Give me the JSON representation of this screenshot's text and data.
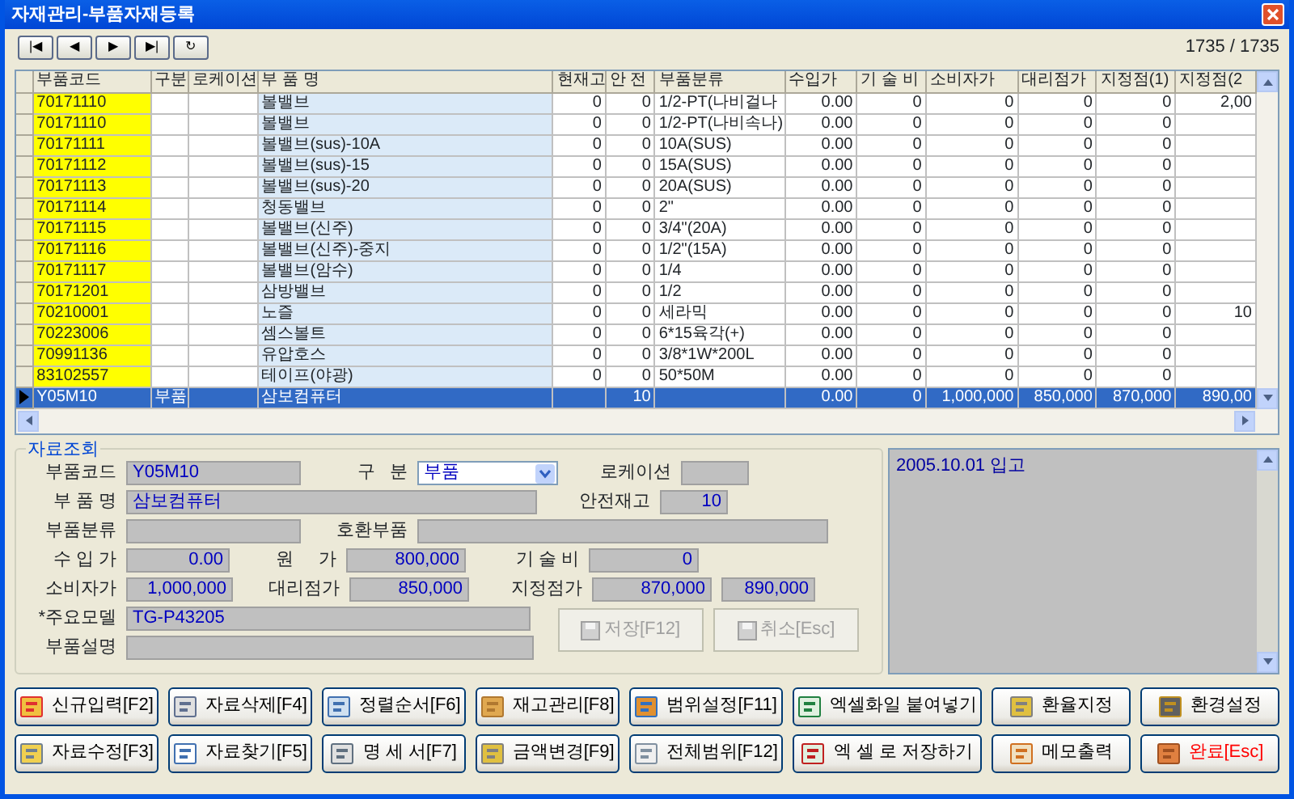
{
  "window": {
    "title": "자재관리-부품자재등록",
    "record_count": "1735 / 1735"
  },
  "navigator": [
    "|◀",
    "◀",
    "▶",
    "▶|",
    "↻"
  ],
  "table": {
    "columns": [
      {
        "label": "부품코드",
        "kind": "code"
      },
      {
        "label": "구분",
        "kind": "text"
      },
      {
        "label": "로케이션",
        "kind": "text"
      },
      {
        "label": "부 품 명",
        "kind": "name"
      },
      {
        "label": "현재고",
        "kind": "number"
      },
      {
        "label": "안 전",
        "kind": "number"
      },
      {
        "label": "부품분류",
        "kind": "text"
      },
      {
        "label": "수입가",
        "kind": "number"
      },
      {
        "label": "기 술 비",
        "kind": "number"
      },
      {
        "label": "소비자가",
        "kind": "number"
      },
      {
        "label": "대리점가",
        "kind": "number"
      },
      {
        "label": "지정점(1)",
        "kind": "number"
      },
      {
        "label": "지정점(2",
        "kind": "number"
      }
    ],
    "rows": [
      {
        "selected": false,
        "cells": [
          "70171110",
          null,
          null,
          "볼밸브",
          "0",
          "0",
          "1/2-PT(나비걸나",
          "0.00",
          "0",
          "0",
          "0",
          "0",
          "2,00"
        ]
      },
      {
        "selected": false,
        "cells": [
          "70171110",
          null,
          null,
          "볼밸브",
          "0",
          "0",
          "1/2-PT(나비속나)",
          "0.00",
          "0",
          "0",
          "0",
          "0",
          null
        ]
      },
      {
        "selected": false,
        "cells": [
          "70171111",
          null,
          null,
          "볼밸브(sus)-10A",
          "0",
          "0",
          "10A(SUS)",
          "0.00",
          "0",
          "0",
          "0",
          "0",
          null
        ]
      },
      {
        "selected": false,
        "cells": [
          "70171112",
          null,
          null,
          "볼밸브(sus)-15",
          "0",
          "0",
          "15A(SUS)",
          "0.00",
          "0",
          "0",
          "0",
          "0",
          null
        ]
      },
      {
        "selected": false,
        "cells": [
          "70171113",
          null,
          null,
          "볼밸브(sus)-20",
          "0",
          "0",
          "20A(SUS)",
          "0.00",
          "0",
          "0",
          "0",
          "0",
          null
        ]
      },
      {
        "selected": false,
        "cells": [
          "70171114",
          null,
          null,
          "청동밸브",
          "0",
          "0",
          "2\"",
          "0.00",
          "0",
          "0",
          "0",
          "0",
          null
        ]
      },
      {
        "selected": false,
        "cells": [
          "70171115",
          null,
          null,
          "볼밸브(신주)",
          "0",
          "0",
          "3/4\"(20A)",
          "0.00",
          "0",
          "0",
          "0",
          "0",
          null
        ]
      },
      {
        "selected": false,
        "cells": [
          "70171116",
          null,
          null,
          "볼밸브(신주)-중지",
          "0",
          "0",
          "1/2\"(15A)",
          "0.00",
          "0",
          "0",
          "0",
          "0",
          null
        ]
      },
      {
        "selected": false,
        "cells": [
          "70171117",
          null,
          null,
          "볼밸브(암수)",
          "0",
          "0",
          "1/4",
          "0.00",
          "0",
          "0",
          "0",
          "0",
          null
        ]
      },
      {
        "selected": false,
        "cells": [
          "70171201",
          null,
          null,
          "삼방밸브",
          "0",
          "0",
          "1/2",
          "0.00",
          "0",
          "0",
          "0",
          "0",
          null
        ]
      },
      {
        "selected": false,
        "cells": [
          "70210001",
          null,
          null,
          "노즐",
          "0",
          "0",
          "세라믹",
          "0.00",
          "0",
          "0",
          "0",
          "0",
          "10"
        ]
      },
      {
        "selected": false,
        "cells": [
          "70223006",
          null,
          null,
          "셈스볼트",
          "0",
          "0",
          "6*15육각(+)",
          "0.00",
          "0",
          "0",
          "0",
          "0",
          null
        ]
      },
      {
        "selected": false,
        "cells": [
          "70991136",
          null,
          null,
          "유압호스",
          "0",
          "0",
          "3/8*1W*200L",
          "0.00",
          "0",
          "0",
          "0",
          "0",
          null
        ]
      },
      {
        "selected": false,
        "cells": [
          "83102557",
          null,
          null,
          "테이프(야광)",
          "0",
          "0",
          "50*50M",
          "0.00",
          "0",
          "0",
          "0",
          "0",
          null
        ]
      },
      {
        "selected": true,
        "cells": [
          "Y05M10",
          "부품",
          null,
          "삼보컴퓨터",
          null,
          "10",
          null,
          "0.00",
          "0",
          "1,000,000",
          "850,000",
          "870,000",
          "890,00"
        ]
      }
    ]
  },
  "form": {
    "title": "자료조회",
    "fields": [
      {
        "label": "부품코드",
        "value": "Y05M10",
        "kind": "text"
      },
      {
        "label": "구   분",
        "value": "부품",
        "kind": "select"
      },
      {
        "label": "로케이션",
        "kind": "text"
      },
      {
        "label": "부 품 명",
        "value": "삼보컴퓨터",
        "kind": "text"
      },
      {
        "label": "안전재고",
        "value": "10",
        "kind": "number"
      },
      {
        "label": "부품분류",
        "kind": "text"
      },
      {
        "label": "호환부품",
        "kind": "text"
      },
      {
        "label": "수 입 가",
        "value": "0.00",
        "kind": "number"
      },
      {
        "label": "원     가",
        "value": "800,000",
        "kind": "number"
      },
      {
        "label": "기 술 비",
        "value": "0",
        "kind": "number"
      },
      {
        "label": "소비자가",
        "value": "1,000,000",
        "kind": "number"
      },
      {
        "label": "대리점가",
        "value": "850,000",
        "kind": "number"
      },
      {
        "label": "지정점가",
        "value": "870,000",
        "kind": "number"
      },
      {
        "value": "890,000",
        "kind": "number"
      },
      {
        "label": "*주요모델",
        "value": "TG-P43205",
        "kind": "text"
      },
      {
        "label": "부품설명",
        "kind": "text"
      }
    ],
    "buttons": [
      {
        "label": "저장[F12]",
        "disabled": true
      },
      {
        "label": "취소[Esc]",
        "disabled": true
      }
    ]
  },
  "memo": {
    "value": "2005.10.01 입고"
  },
  "buttons": [
    {
      "label": "신규입력[F2]"
    },
    {
      "label": "자료삭제[F4]"
    },
    {
      "label": "정렬순서[F6]"
    },
    {
      "label": "재고관리[F8]"
    },
    {
      "label": "범위설정[F11]"
    },
    {
      "label": "엑셀화일 붙여넣기"
    },
    {
      "label": "환율지정"
    },
    {
      "label": "환경설정"
    },
    {
      "label": "자료수정[F3]"
    },
    {
      "label": "자료찾기[F5]"
    },
    {
      "label": "명 세 서[F7]"
    },
    {
      "label": "금액변경[F9]"
    },
    {
      "label": "전체범위[F12]"
    },
    {
      "label": "엑 셀 로 저장하기"
    },
    {
      "label": "메모출력"
    },
    {
      "label": "완료[Esc]",
      "color": "#ff0000"
    }
  ]
}
